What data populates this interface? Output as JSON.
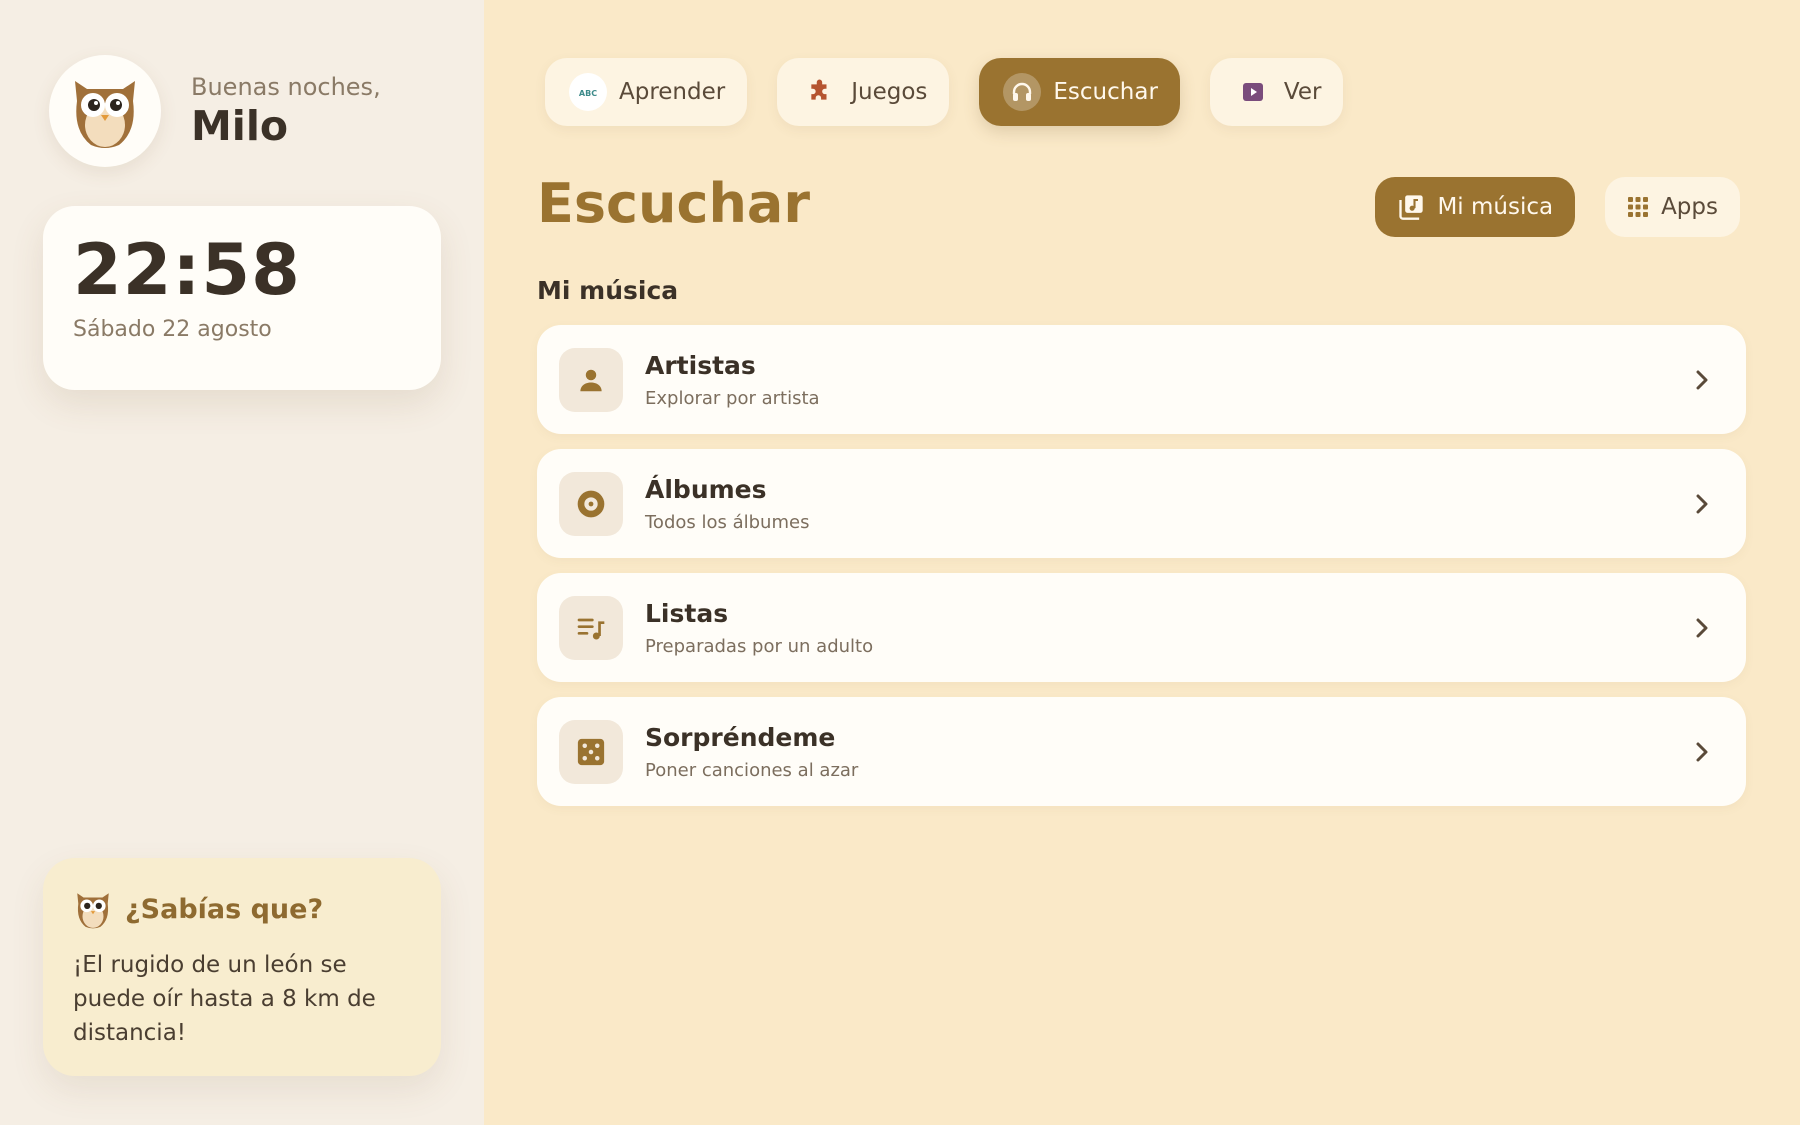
{
  "user": {
    "greeting": "Buenas noches,",
    "name": "Milo",
    "avatar_icon": "owl-icon"
  },
  "clock": {
    "time": "22:58",
    "date": "Sábado 22 agosto"
  },
  "tabs": [
    {
      "label": "Aprender",
      "icon": "abc-icon",
      "active": false
    },
    {
      "label": "Juegos",
      "icon": "puzzle-icon",
      "active": false
    },
    {
      "label": "Escuchar",
      "icon": "headphones-icon",
      "active": true
    },
    {
      "label": "Ver",
      "icon": "play-video-icon",
      "active": false
    }
  ],
  "page": {
    "title": "Escuchar",
    "section_label": "Mi música",
    "actions": {
      "my_music_label": "Mi música",
      "apps_label": "Apps"
    }
  },
  "items": [
    {
      "title": "Artistas",
      "subtitle": "Explorar por artista",
      "icon": "person-icon"
    },
    {
      "title": "Álbumes",
      "subtitle": "Todos los álbumes",
      "icon": "disc-icon"
    },
    {
      "title": "Listas",
      "subtitle": "Preparadas por un adulto",
      "icon": "playlist-icon"
    },
    {
      "title": "Sorpréndeme",
      "subtitle": "Poner canciones al azar",
      "icon": "dice-icon"
    }
  ],
  "fact": {
    "title": "¿Sabías que?",
    "text": "¡El rugido de un león se puede oír hasta a 8 km de distancia!"
  },
  "colors": {
    "background": "#FAE9C8",
    "sidebar": "#F5EEE4",
    "accent": "#9A7330",
    "card": "#FFFDF8",
    "text_dark": "#3B3127",
    "text_muted": "#8A7A66"
  }
}
